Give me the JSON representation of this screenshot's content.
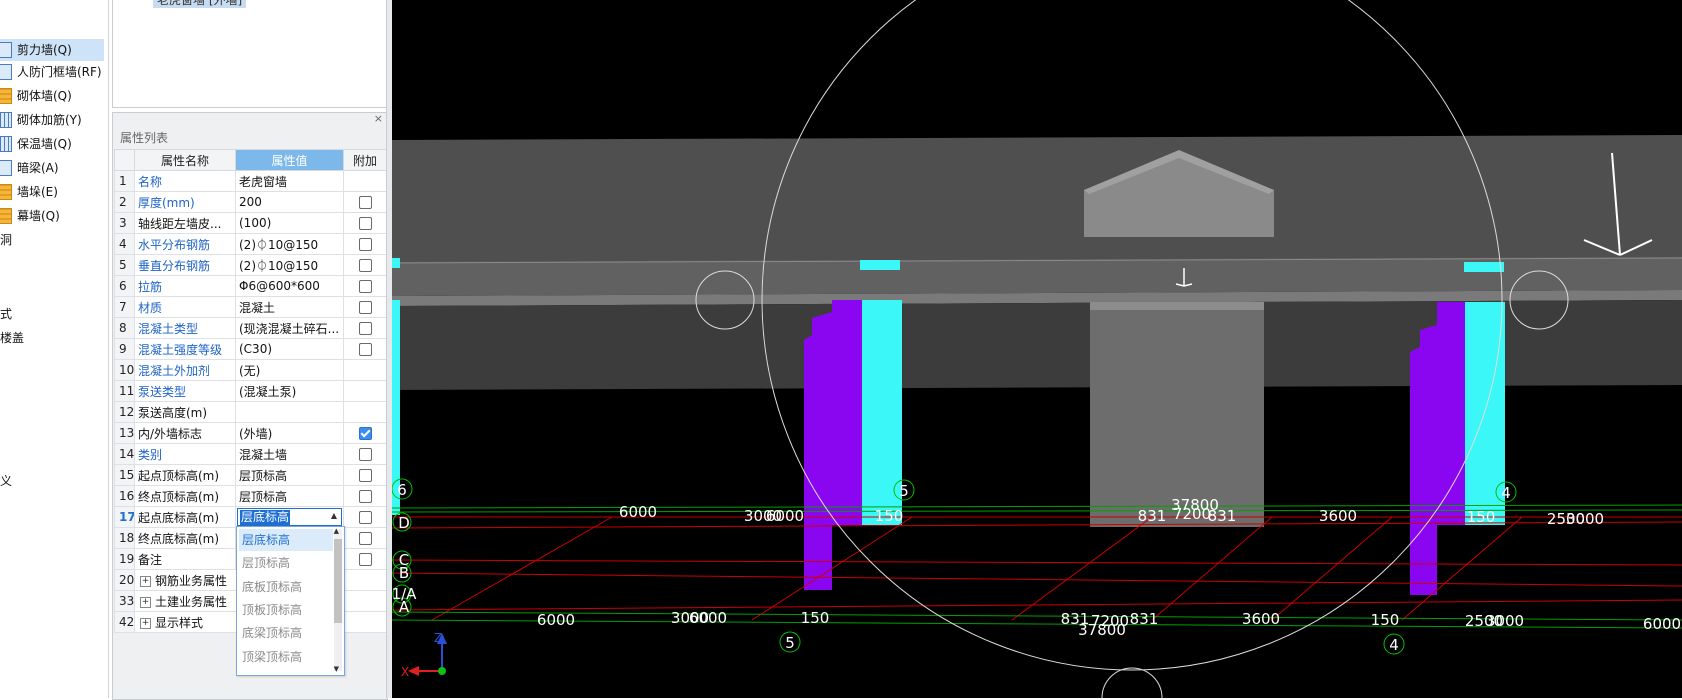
{
  "left_tree": {
    "items": [
      {
        "label": "剪力墙(Q)",
        "icon": "shear-wall-icon",
        "selected": true
      },
      {
        "label": "人防门框墙(RF)",
        "icon": "door-frame-wall-icon"
      },
      {
        "label": "砌体墙(Q)",
        "icon": "masonry-wall-icon"
      },
      {
        "label": "砌体加筋(Y)",
        "icon": "masonry-rebar-icon"
      },
      {
        "label": "保温墙(Q)",
        "icon": "insulation-wall-icon"
      },
      {
        "label": "暗梁(A)",
        "icon": "hidden-beam-icon"
      },
      {
        "label": "墙垛(E)",
        "icon": "wall-pier-icon"
      },
      {
        "label": "幕墙(Q)",
        "icon": "curtain-wall-icon"
      },
      {
        "label": "洞",
        "icon": ""
      },
      {
        "label": "式",
        "icon": ""
      },
      {
        "label": "楼盖",
        "icon": ""
      },
      {
        "label": "义",
        "icon": ""
      }
    ]
  },
  "component_list": {
    "selected_label": "老虎窗墙 [外墙]"
  },
  "property_panel": {
    "title": "属性列表",
    "close": "×",
    "columns": [
      "属性名称",
      "属性值",
      "附加"
    ],
    "rows": [
      {
        "no": "1",
        "name": "名称",
        "value": "老虎窗墙",
        "blue": true,
        "check": null
      },
      {
        "no": "2",
        "name": "厚度(mm)",
        "value": "200",
        "blue": true,
        "check": false
      },
      {
        "no": "3",
        "name": "轴线距左墙皮...",
        "value": "(100)",
        "blue": false,
        "check": false
      },
      {
        "no": "4",
        "name": "水平分布钢筋",
        "value": "(2)⏀10@150",
        "blue": true,
        "check": false
      },
      {
        "no": "5",
        "name": "垂直分布钢筋",
        "value": "(2)⏀10@150",
        "blue": true,
        "check": false
      },
      {
        "no": "6",
        "name": "拉筋",
        "value": "Φ6@600*600",
        "blue": true,
        "check": false
      },
      {
        "no": "7",
        "name": "材质",
        "value": "混凝土",
        "blue": true,
        "check": false
      },
      {
        "no": "8",
        "name": "混凝土类型",
        "value": "(现浇混凝土碎石...",
        "blue": true,
        "check": false
      },
      {
        "no": "9",
        "name": "混凝土强度等级",
        "value": "(C30)",
        "blue": true,
        "check": false
      },
      {
        "no": "10",
        "name": "混凝土外加剂",
        "value": "(无)",
        "blue": true,
        "check": null
      },
      {
        "no": "11",
        "name": "泵送类型",
        "value": "(混凝土泵)",
        "blue": true,
        "check": null
      },
      {
        "no": "12",
        "name": "泵送高度(m)",
        "value": "",
        "blue": false,
        "check": null
      },
      {
        "no": "13",
        "name": "内/外墙标志",
        "value": "(外墙)",
        "blue": false,
        "check": true
      },
      {
        "no": "14",
        "name": "类别",
        "value": "混凝土墙",
        "blue": true,
        "check": false
      },
      {
        "no": "15",
        "name": "起点顶标高(m)",
        "value": "层顶标高",
        "blue": false,
        "check": false
      },
      {
        "no": "16",
        "name": "终点顶标高(m)",
        "value": "层顶标高",
        "blue": false,
        "check": false
      },
      {
        "no": "17",
        "name": "起点底标高(m)",
        "value": "层底标高",
        "blue": false,
        "check": false,
        "editing": true
      },
      {
        "no": "18",
        "name": "终点底标高(m)",
        "value": "",
        "blue": false,
        "check": false
      },
      {
        "no": "19",
        "name": "备注",
        "value": "",
        "blue": false,
        "check": false
      },
      {
        "no": "20",
        "name": "钢筋业务属性",
        "value": "",
        "blue": false,
        "check": null,
        "group": true
      },
      {
        "no": "33",
        "name": "土建业务属性",
        "value": "",
        "blue": false,
        "check": null,
        "group": true
      },
      {
        "no": "42",
        "name": "显示样式",
        "value": "",
        "blue": false,
        "check": null,
        "group": true
      }
    ]
  },
  "dropdown": {
    "options": [
      "层底标高",
      "层顶标高",
      "底板顶标高",
      "顶板顶标高",
      "底梁顶标高",
      "顶梁顶标高"
    ],
    "selected_index": 0
  },
  "viewport": {
    "dims_top": [
      "6000",
      "3000",
      "6000",
      "150",
      "37800",
      "831",
      "7200",
      "831",
      "3600",
      "150",
      "2500",
      "3000"
    ],
    "dims_bottom": [
      "6000",
      "3000",
      "6000",
      "150",
      "831",
      "7200",
      "831",
      "3600",
      "150",
      "2500",
      "3000",
      "6000",
      "37800"
    ],
    "axis_labels_top": [
      "6",
      "5",
      "4"
    ],
    "axis_labels_left": [
      "D",
      "C",
      "B",
      "1/A",
      "A"
    ],
    "axis_labels_bottom": [
      "5",
      "4"
    ],
    "axis_x": "X",
    "axis_z": "Z",
    "colors": {
      "cyan": "#3cf7f7",
      "purple": "#8a06f0",
      "grid_red": "#cc0000",
      "grid_green": "#00a000",
      "slab": "#5a5a5a"
    }
  }
}
